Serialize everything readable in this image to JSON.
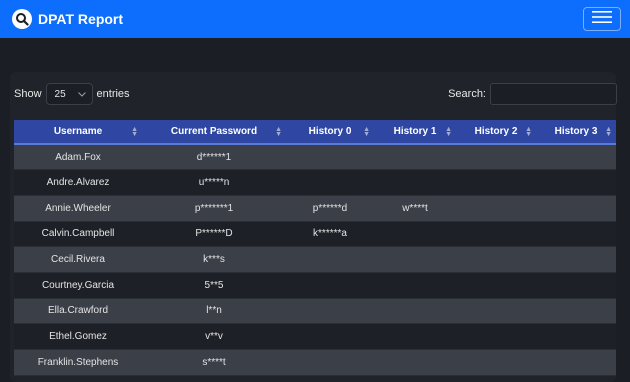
{
  "navbar": {
    "brand": "DPAT Report",
    "logo_icon": "magnifier-logo-icon",
    "toggle_icon": "hamburger-menu-icon",
    "color": "#0d6efd"
  },
  "controls": {
    "show_label": "Show",
    "entries_value": "25",
    "entries_label": "entries",
    "search_label": "Search:",
    "search_value": ""
  },
  "table": {
    "header_color": "#2f47a3",
    "columns": [
      "Username",
      "Current Password",
      "History 0",
      "History 1",
      "History 2",
      "History 3"
    ],
    "rows": [
      [
        "Adam.Fox",
        "d******1",
        "",
        "",
        "",
        ""
      ],
      [
        "Andre.Alvarez",
        "u*****n",
        "",
        "",
        "",
        ""
      ],
      [
        "Annie.Wheeler",
        "p*******1",
        "p******d",
        "w****t",
        "",
        ""
      ],
      [
        "Calvin.Campbell",
        "P******D",
        "k******a",
        "",
        "",
        ""
      ],
      [
        "Cecil.Rivera",
        "k***s",
        "",
        "",
        "",
        ""
      ],
      [
        "Courtney.Garcia",
        "5**5",
        "",
        "",
        "",
        ""
      ],
      [
        "Ella.Crawford",
        "l**n",
        "",
        "",
        "",
        ""
      ],
      [
        "Ethel.Gomez",
        "v**v",
        "",
        "",
        "",
        ""
      ],
      [
        "Franklin.Stephens",
        "s****t",
        "",
        "",
        "",
        ""
      ]
    ]
  }
}
